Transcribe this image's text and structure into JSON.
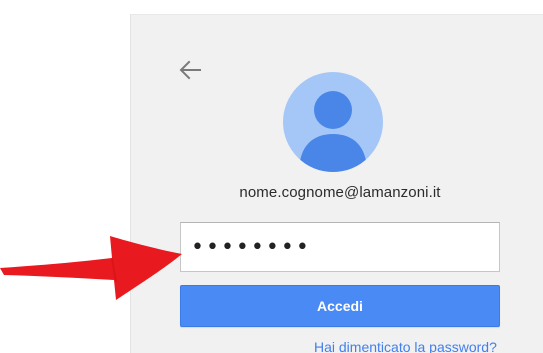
{
  "account": {
    "email": "nome.cognome@lamanzoni.it"
  },
  "password": {
    "value": "••••••••"
  },
  "actions": {
    "signin_label": "Accedi",
    "forgot_label": "Hai dimenticato la password?"
  },
  "icons": {
    "back": "arrow-left-icon",
    "avatar": "default-user-avatar-icon",
    "annotation": "red-hand-drawn-arrow"
  },
  "colors": {
    "card_bg": "#f1f1f1",
    "avatar_bg": "#a5c7f7",
    "avatar_figure": "#4a86e8",
    "button_bg": "#4a8af4",
    "link": "#427fed",
    "annotation": "#e8191f"
  }
}
